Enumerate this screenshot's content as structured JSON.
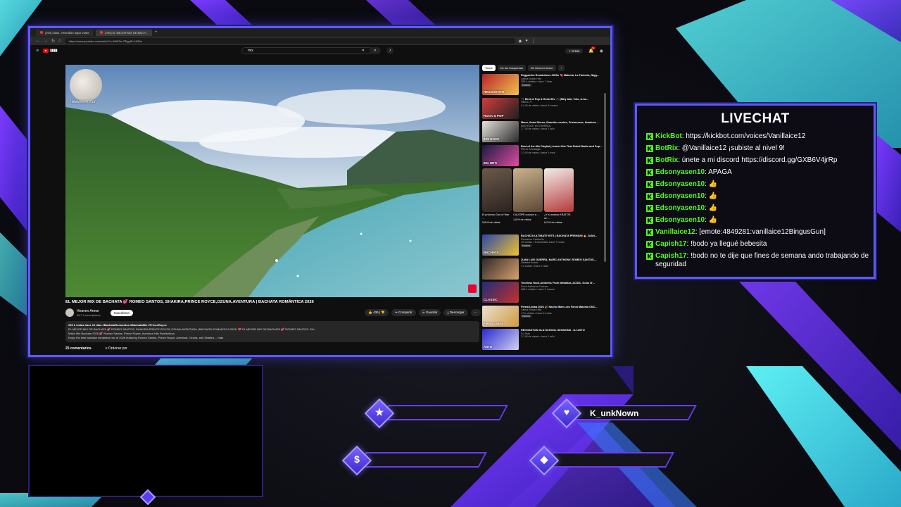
{
  "browser": {
    "tabs": [
      {
        "label": "(294) Lilola - Fera Ákin Sapo Video"
      },
      {
        "label": "(294) EL MEJOR MIX DE BACH..."
      }
    ],
    "url": "https://www.youtube.com/watch?v=AfiW3u-OPggSt=1565s"
  },
  "youtube": {
    "search_value": "mix",
    "create_label": "+ Crear",
    "notification_count": "9+",
    "video": {
      "overlay_label": "HeavenArmor",
      "title": "EL MEJOR MIX DE BACHATA 💕 ROMEO SANTOS, SHAKIRA,PRINCE ROYCE,OZUNA,AVENTURA | BACHATA ROMÁNTICA 2026",
      "channel": "Heaven Armor",
      "subscribers": "46,7 k suscriptores",
      "subscribe_label": "Suscribirse",
      "likes": "436",
      "share_label": "Compartir",
      "save_label": "Guardar",
      "download_label": "Descargar",
      "description_stats": "293 k vistas  hace 12 días  #BachataRomantica #BachataMix #PrinceRoyce",
      "description_line1": "EL MEJOR MIX DE BACHATA 💕 ROMEO SANTOS, SHAKIRA,PRINCE ROYCE,OZUNA,AVENTURA | BACHATA ROMÁNTICA 2026: ❤️ EL MEJOR MIX DE BACHATA 💕 ROMEO SANTOS, SH...",
      "description_line2": "Mejor Mix Bachata 2026 💕 Romeo Santos, Prince Royce, Aventura Hits Románticos",
      "description_line3": "Enjoy the best bachata romántica mix of 2026 featuring Romeo Santos, Prince Royce, Aventura, Ozuna, and Shakira.  ...más",
      "comments_count": "25 comentarios",
      "sort_label": "Ordenar por"
    },
    "chips": [
      "Todos",
      "De tus búsquedas",
      "De Heaven Armor"
    ],
    "recommendations_top": [
      {
        "title": "Reggaeton Románticos 2000s 💘 Maluma, La Factoría, Nigg...",
        "channel": "Latina Music Hits",
        "meta": "255 k visitas • hace 7 días",
        "badge": "Nuevo"
      },
      {
        "title": "🎵 Best of Pop & Rock 80s 🎵 (Billy Idol, Toto, A-ha...",
        "channel": "vibes1 77",
        "meta": "3,4 M de vistas • hace 3 meses"
      },
      {
        "title": "Mano, Soda Stereo, Enanitos verdes, Prisioneros, Hombres ...",
        "channel": "80S ROCK en ESPAÑOL",
        "meta": "1,7 M de vistas • hace 1 año"
      },
      {
        "title": "Best of the 80s Playlist | Iconic Hits That Ruled Radio and Pop...",
        "channel": "Pierce Nostalgia",
        "meta": "1,3 M de vistas • hace 1 mes"
      }
    ],
    "shorts": [
      {
        "title": "El próximo God of War ...",
        "views": "5,8 M de vistas"
      },
      {
        "title": "CALÍOPE conoce a ...",
        "views": "1,8 M de vistas"
      },
      {
        "title": "¿Y si ambos KRATOS se ...",
        "views": "6,2 M de vistas"
      }
    ],
    "recommendations_bottom": [
      {
        "title": "BACHATA ULTIMATE HITS | BACHATA PREMIUM 🔥 JUAN...",
        "channel": "Romance Caribeño",
        "meta": "19 visitas • Transmitido hace 7 horas",
        "badge": "Nuevo"
      },
      {
        "title": "JUAN LUIS GUERRA, MARC ANTHONY, ROMEO SANTOS,...",
        "channel": "Heaven Armor",
        "meta": "71 visitas • hace 2 días"
      },
      {
        "title": "Timeless Rock Anthems From Metallica, AC/DC, Guns N'...",
        "channel": "Rock Anthems Forever",
        "meta": "408 k visitas • hace 2 meses"
      },
      {
        "title": "Fiesta Latina 2026 🎉 Nacho Mian Luis Fonsi Maluma CNC...",
        "channel": "Latina Music Hits",
        "meta": "17 k visitas • hace 11 días",
        "badge": "Nuevo"
      },
      {
        "title": "REGGAETON OLD SCHOOL SESSIONS - DJ ASTO",
        "channel": "DJ Asto",
        "meta": "2,1 M de vistas • hace 1 año"
      }
    ],
    "thumb_labels": [
      "REGGAETON",
      "ROCK & POP",
      "80S ROCK",
      "80s HITS",
      "BACHATA",
      "",
      "CLASSIC",
      "Fiesta Latina",
      "ASTO"
    ]
  },
  "livechat": {
    "title": "LIVECHAT",
    "messages": [
      {
        "user": "KickBot",
        "text": "https://kickbot.com/voices/Vanillaice12"
      },
      {
        "user": "BotRix",
        "text": "@Vanillaice12 ¡subiste al nivel 9!"
      },
      {
        "user": "BotRix",
        "text": "únete a mi discord https://discord.gg/GXB6V4jrRp"
      },
      {
        "user": "Edsonyasen10",
        "text": "APAGA"
      },
      {
        "user": "Edsonyasen10",
        "text": "👍"
      },
      {
        "user": "Edsonyasen10",
        "text": "👍"
      },
      {
        "user": "Edsonyasen10",
        "text": "👍"
      },
      {
        "user": "Edsonyasen10",
        "text": "👍"
      },
      {
        "user": "Vanillaice12",
        "text": "[emote:4849281:vanillaice12BingusGun]"
      },
      {
        "user": "Capish17",
        "text": "!bodo ya llegué bebesita"
      },
      {
        "user": "Capish17",
        "text": "!bodo no te dije que fines de semana ando trabajando de seguridad"
      }
    ]
  },
  "socials": {
    "heart_label": "K_unkNown",
    "star_label": "",
    "dollar_label": "",
    "diamond_label": ""
  },
  "colors": {
    "accent": "#5b5cf2",
    "cyan": "#3fe0e8",
    "kick_green": "#53fc18"
  },
  "icons": [
    "star-icon",
    "heart-icon",
    "dollar-icon",
    "diamond-icon",
    "kick-icon",
    "search-icon",
    "mic-icon",
    "like-icon",
    "share-icon"
  ]
}
